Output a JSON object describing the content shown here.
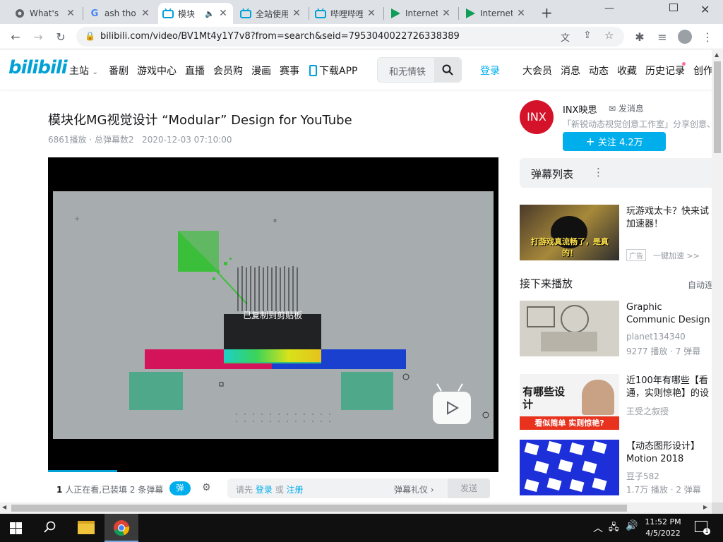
{
  "browser": {
    "tabs": [
      {
        "title": "What's",
        "icon": "chrome-icon"
      },
      {
        "title": "ash tho",
        "icon": "google-icon"
      },
      {
        "title": "模块",
        "icon": "bilibili-icon"
      },
      {
        "title": "全站使用",
        "icon": "bilibili-icon"
      },
      {
        "title": "哔哩哔哩",
        "icon": "bilibili-icon"
      },
      {
        "title": "Internet",
        "icon": "play-icon"
      },
      {
        "title": "Internet",
        "icon": "play-icon"
      }
    ],
    "url": "bilibili.com/video/BV1Mt4y1Y7v8?from=search&seid=7953040022726338389"
  },
  "header": {
    "logo": "bilibili",
    "nav": [
      "主站",
      "番剧",
      "游戏中心",
      "直播",
      "会员购",
      "漫画",
      "赛事",
      "下载APP"
    ],
    "search_placeholder": "和无情铁",
    "login": "登录",
    "right_nav": [
      "大会员",
      "消息",
      "动态",
      "收藏",
      "历史记录",
      "创作"
    ]
  },
  "video": {
    "title": "模块化MG视觉设计 “Modular” Design for YouTube",
    "views": "6861播放",
    "danmaku_total": "总弹幕数2",
    "date": "2020-12-03 07:10:00",
    "toast": "已复制到剪贴板"
  },
  "sendbar": {
    "watching_count": "1",
    "watching_text": "人正在看,已装填 2 条弹幕",
    "danmaku_toggle": "弹",
    "prompt_prefix": "请先",
    "login": "登录",
    "or": "或",
    "register": "注册",
    "etiquette": "弹幕礼仪",
    "send": "发送"
  },
  "uploader": {
    "avatar_text": "INX",
    "name": "INX映思",
    "message": "发消息",
    "desc": "「新锐动态视觉创意工作室」分享创意、",
    "follow": "关注 4.2万"
  },
  "danmaku_list": {
    "title": "弹幕列表"
  },
  "ad": {
    "title": "玩游戏太卡？快来试加速器！",
    "badge": "广告",
    "cta": "一键加速 >>",
    "thumb_caption": "打游戏真流畅了，是真的！"
  },
  "up_next": {
    "title": "接下来播放",
    "autoplay": "自动连",
    "items": [
      {
        "title": "Graphic Communic Design",
        "author": "planet134340",
        "stats": "9277 播放 · 7 弹幕"
      },
      {
        "title": "近100年有哪些【看通，实则惊艳】的设",
        "author": "王受之叙授",
        "stats": "",
        "thumb_text_1": "有哪些设计",
        "thumb_text_2": "看似简单 实则惊艳?"
      },
      {
        "title": "【动态图形设计】Motion 2018",
        "author": "豆子582",
        "stats": "1.7万 播放 · 2 弹幕"
      }
    ]
  },
  "taskbar": {
    "time": "11:52 PM",
    "date": "4/5/2022"
  },
  "colors": {
    "bili_blue": "#00a1d6",
    "bili_pink": "#fb7299",
    "follow_blue": "#00aeec"
  }
}
